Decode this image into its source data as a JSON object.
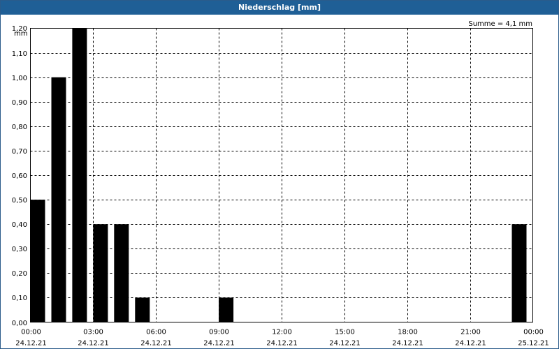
{
  "window": {
    "title": "Niederschlag [mm]"
  },
  "chart_data": {
    "type": "bar",
    "title": "Niederschlag [mm]",
    "summary": "Summe = 4,1 mm",
    "ylabel": "mm",
    "ylim": [
      0,
      1.2
    ],
    "yticks": [
      "0,00",
      "0,10",
      "0,20",
      "0,30",
      "0,40",
      "0,50",
      "0,60",
      "0,70",
      "0,80",
      "0,90",
      "1,00",
      "1,10",
      "1,20"
    ],
    "xlim_hours": [
      0,
      24
    ],
    "xticks": [
      {
        "time": "00:00",
        "date": "24.12.21",
        "hour": 0
      },
      {
        "time": "03:00",
        "date": "24.12.21",
        "hour": 3
      },
      {
        "time": "06:00",
        "date": "24.12.21",
        "hour": 6
      },
      {
        "time": "09:00",
        "date": "24.12.21",
        "hour": 9
      },
      {
        "time": "12:00",
        "date": "24.12.21",
        "hour": 12
      },
      {
        "time": "15:00",
        "date": "24.12.21",
        "hour": 15
      },
      {
        "time": "18:00",
        "date": "24.12.21",
        "hour": 18
      },
      {
        "time": "21:00",
        "date": "24.12.21",
        "hour": 21
      },
      {
        "time": "00:00",
        "date": "25.12.21",
        "hour": 24
      }
    ],
    "categories": [
      "00:00",
      "01:00",
      "02:00",
      "03:00",
      "04:00",
      "05:00",
      "06:00",
      "07:00",
      "08:00",
      "09:00",
      "10:00",
      "11:00",
      "12:00",
      "13:00",
      "14:00",
      "15:00",
      "16:00",
      "17:00",
      "18:00",
      "19:00",
      "20:00",
      "21:00",
      "22:00",
      "23:00"
    ],
    "values": [
      0.5,
      1.0,
      1.2,
      0.4,
      0.4,
      0.1,
      0,
      0,
      0,
      0.1,
      0,
      0,
      0,
      0,
      0,
      0,
      0,
      0,
      0,
      0,
      0,
      0,
      0,
      0.4
    ],
    "grid": true,
    "colors": {
      "bar": "#000000",
      "titlebar": "#1f5f96",
      "grid": "#000000"
    }
  }
}
